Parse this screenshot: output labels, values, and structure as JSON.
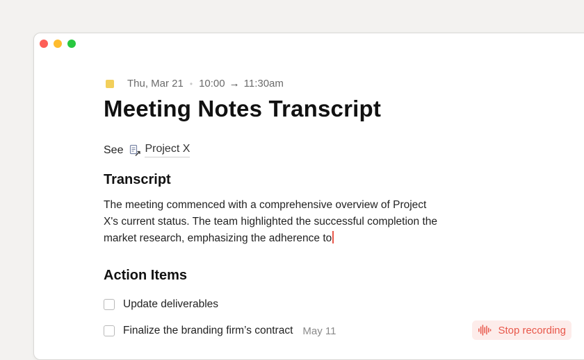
{
  "note": {
    "date": "Thu, Mar 21",
    "time_start": "10:00",
    "time_end": "11:30am",
    "title": "Meeting Notes Transcript",
    "see_label": "See",
    "linked_doc": "Project X"
  },
  "transcript": {
    "heading": "Transcript",
    "lines": [
      "The meeting commenced with a comprehensive overview of Project",
      "X's current status. The team highlighted the successful completion the",
      "market research, emphasizing the adherence to"
    ]
  },
  "action_items": {
    "heading": "Action Items",
    "items": [
      {
        "label": "Update deliverables",
        "due": "",
        "checked": false
      },
      {
        "label": "Finalize the branding firm’s contract",
        "due": "May 11",
        "checked": false
      }
    ]
  },
  "recording": {
    "stop_label": "Stop recording"
  },
  "colors": {
    "accent": "#e8574a",
    "accent_bg": "#fdecea",
    "date_square": "#f2cf5b"
  },
  "icons": {
    "date": "calendar-square-icon",
    "linked_doc": "doc-link-icon",
    "recording": "waveform-icon"
  }
}
